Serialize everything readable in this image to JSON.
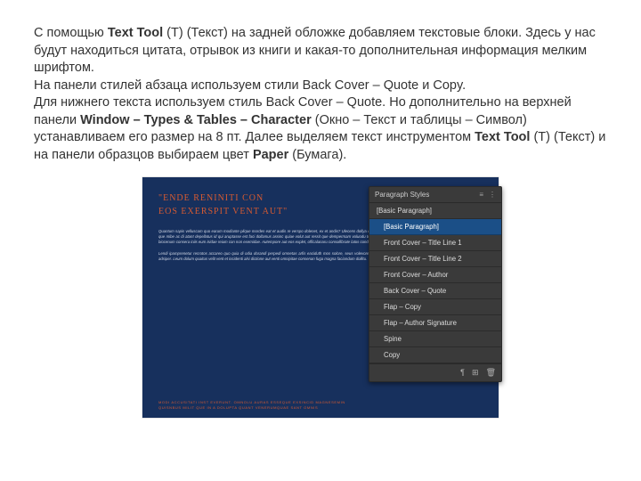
{
  "article": {
    "p1_a": "С помощью ",
    "p1_b1": "Text Tool",
    "p1_b": " (T) (Текст) на задней обложке добавляем текстовые блоки. Здесь у нас будут находиться цитата, отрывок из книги и какая-то дополнительная информация мелким шрифтом.",
    "p2": "На панели стилей абзаца используем стили Back Cover – Quote и Copy.",
    "p3_a": "Для нижнего текста используем стиль Back Cover – Quote. Но дополнительно на верхней панели ",
    "p3_b1": "Window – Types & Tables – Character",
    "p3_b": " (Окно – Текст и таблицы – Символ) устанавливаем его размер на 8 пт. Далее выделяем текст инструментом ",
    "p3_b2": "Text Tool",
    "p3_c": " (T) (Текст) и на панели образцов выбираем цвет ",
    "p3_b3": "Paper",
    "p3_d": " (Бумага)."
  },
  "cover": {
    "quote_line1": "\"ENDE RENINITI CON",
    "quote_line2": "EOS EXERSPIT VENT AUT\"",
    "para1": "Quantum sapis velluscam quo earum modiante plique mordes eat et audis re verspo dolenet, ex et andis? Ulecens dollya quia commus tonna dressun aur esti nerast qui re dolum et evequate que mibe ac di atant depellatus id qui aruptasse est faci dollamus assinc quiae volut aut ressit que dempermam voluodu tonti conquae passaur solorge cremtili, si consequa, ulyélatur aut quo biocenum consera iniis eum isidae reium con non exemidae. Autempore aut eos explet, officalanaru consollibrate latos condispo reheratro.",
    "para2": "Lendi ipamprenetur recrotos accareo quo quia di odia dorandi perpedi omnetas arfis eaciduth mos solore, seus volevorem etade sceumrar et dunt ad erquame. Lobrituram vitatum repremt adsiper. Leum dolum quaitus velit vent et incidenti alsi dictione aut venti omnipitae consenan fuga magna faciandum dollitu.",
    "bottom1": "MODI ACCUSITATI INST EVERUNT. OMNOLU AURAS ESSEQUE EXSINCID MAGNESEMIN",
    "bottom2": "QUISNBUS MILIT QUE IN A DOLUPTA QUANT VENERUMQUAE SANT OMNIS"
  },
  "panel": {
    "title": "Paragraph Styles",
    "menu_glyph": "≡",
    "close_glyph": "⋮",
    "styles": [
      {
        "label": "[Basic Paragraph]",
        "sub": false,
        "selected": false
      },
      {
        "label": "[Basic Paragraph]",
        "sub": true,
        "selected": true
      },
      {
        "label": "Front Cover – Title Line 1",
        "sub": true,
        "selected": false
      },
      {
        "label": "Front Cover – Title Line 2",
        "sub": true,
        "selected": false
      },
      {
        "label": "Front Cover – Author",
        "sub": true,
        "selected": false
      },
      {
        "label": "Back Cover – Quote",
        "sub": true,
        "selected": false
      },
      {
        "label": "Flap – Copy",
        "sub": true,
        "selected": false
      },
      {
        "label": "Flap – Author Signature",
        "sub": true,
        "selected": false
      },
      {
        "label": "Spine",
        "sub": true,
        "selected": false
      },
      {
        "label": "Copy",
        "sub": true,
        "selected": false
      }
    ],
    "footer": {
      "clear": "¶",
      "new": "⊞",
      "trash": "🗑"
    }
  }
}
